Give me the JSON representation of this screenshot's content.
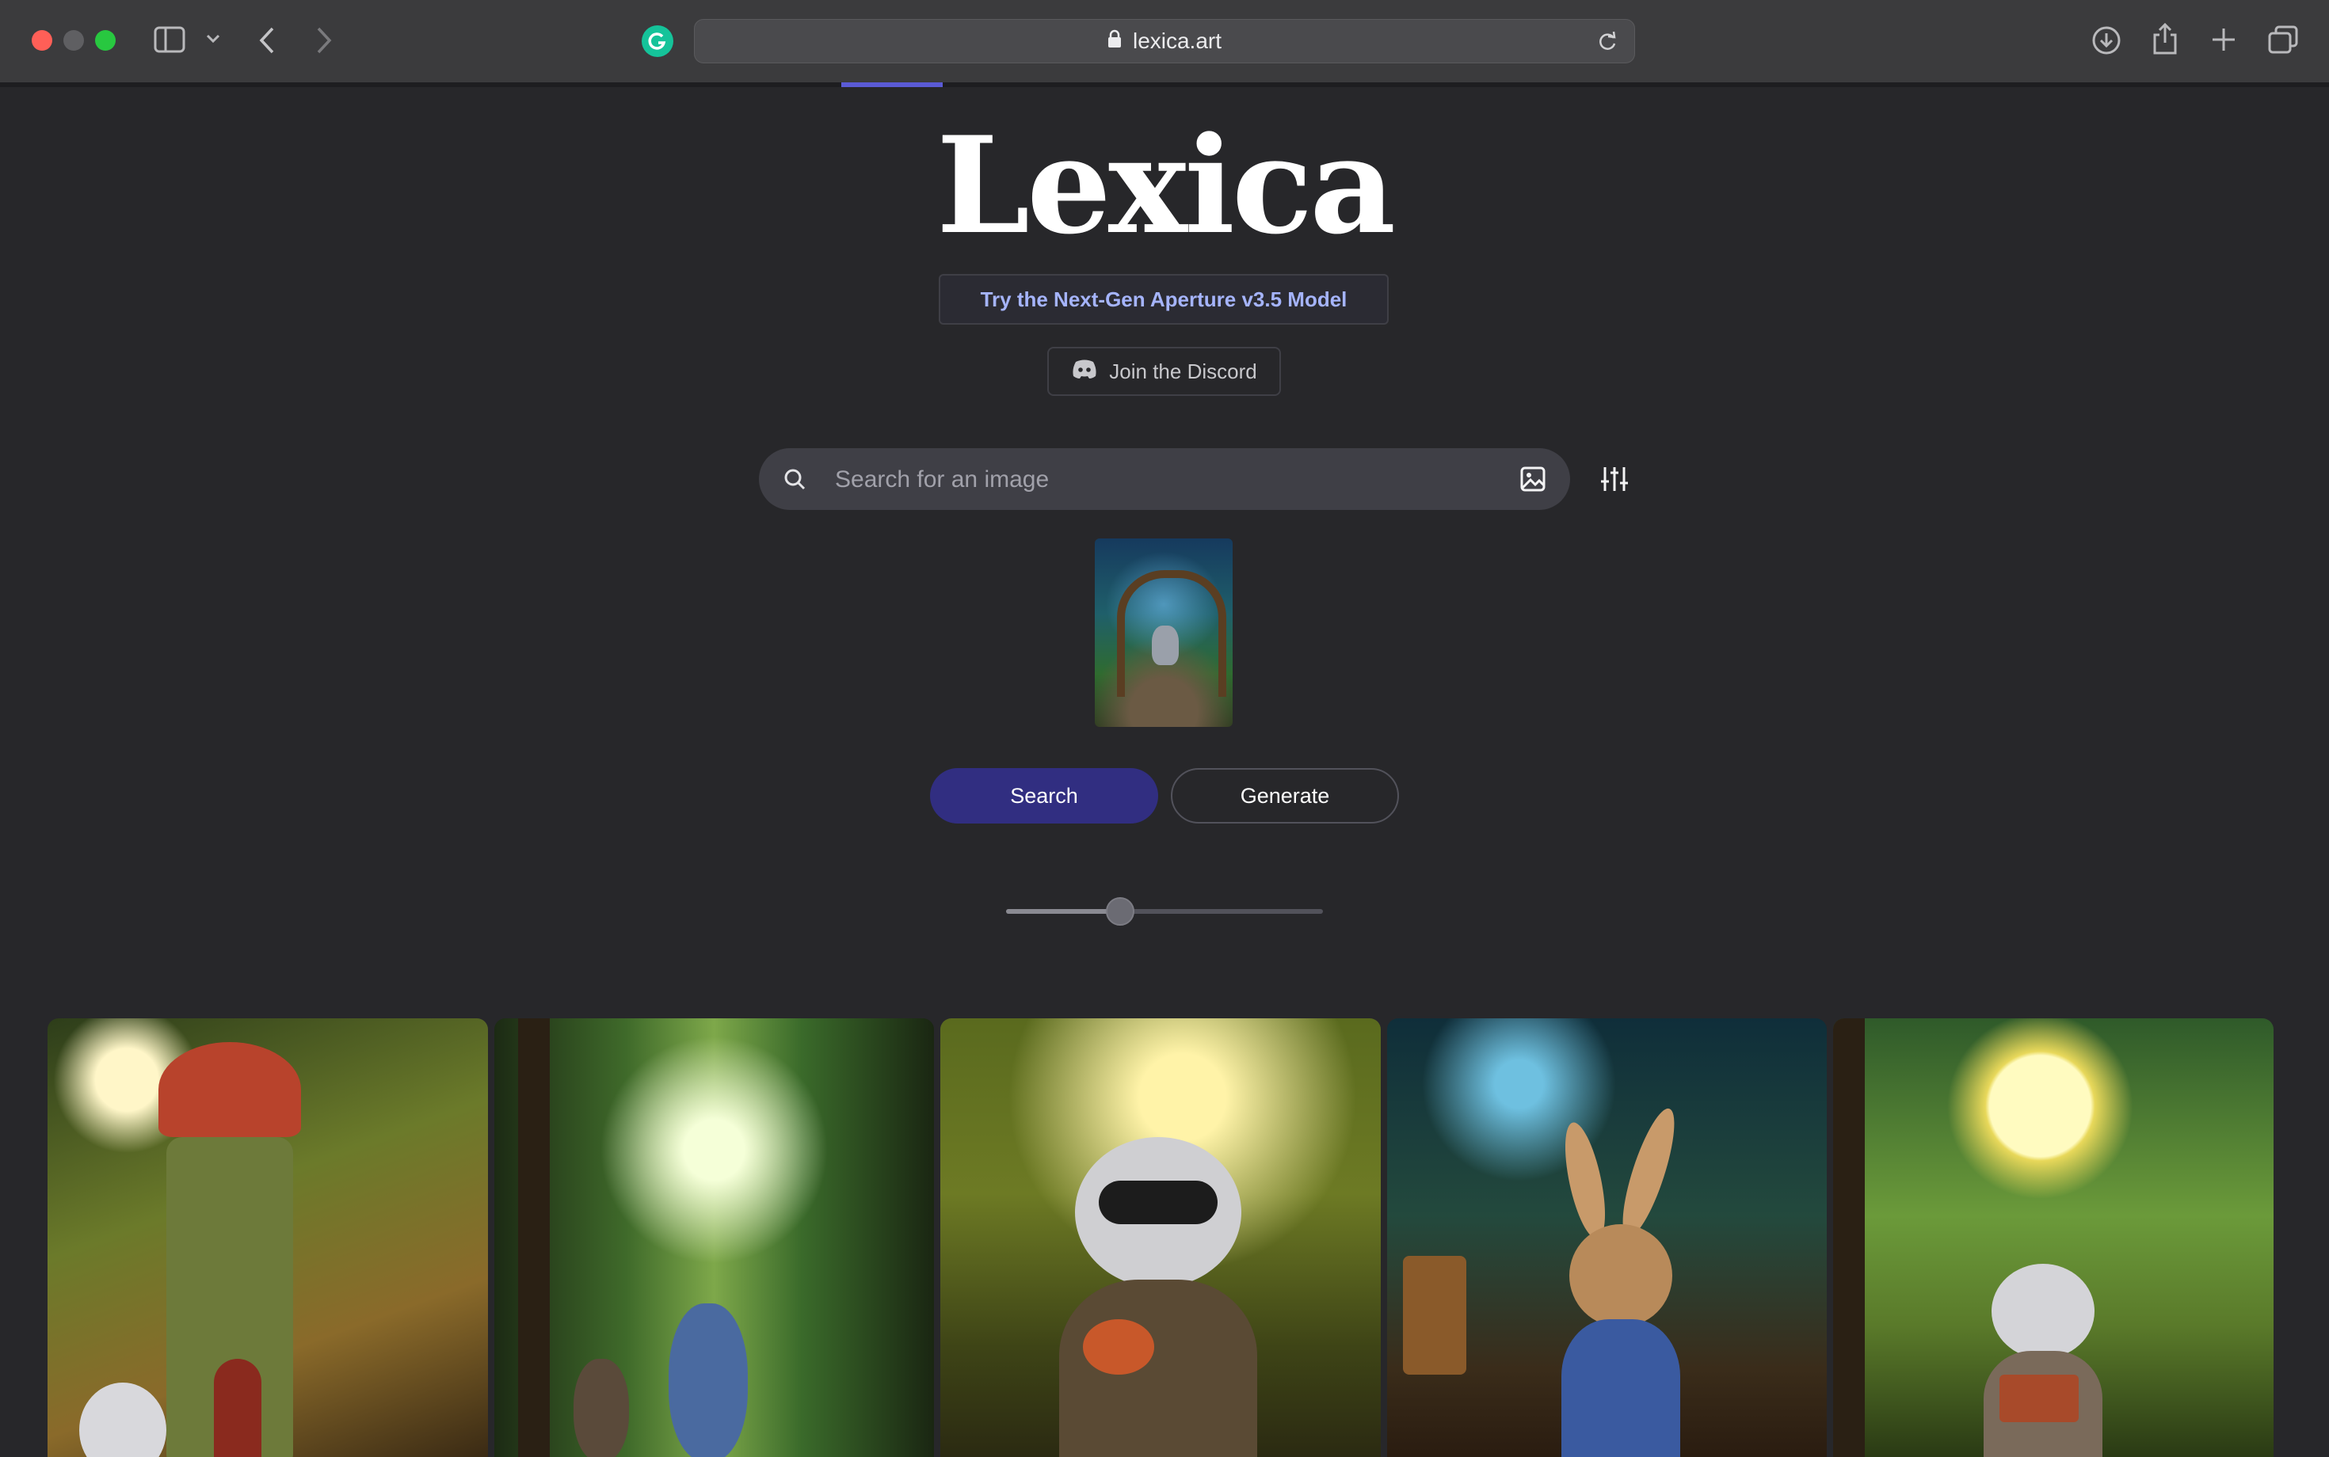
{
  "browser": {
    "url": "lexica.art",
    "icons": {
      "sidebar": "sidebar-icon",
      "back": "chevron-left-icon",
      "forward": "chevron-right-icon",
      "extension": "grammarly-icon",
      "lock": "lock-icon",
      "reload": "reload-icon",
      "downloads": "download-icon",
      "share": "share-icon",
      "new_tab": "plus-icon",
      "tabs": "tabs-overview-icon"
    }
  },
  "page": {
    "logo": "Lexica",
    "promo_label": "Try the Next-Gen Aperture v3.5 Model",
    "discord_label": "Join the Discord",
    "search": {
      "placeholder": "Search for an image",
      "value": ""
    },
    "buttons": {
      "search": "Search",
      "generate": "Generate"
    },
    "zoom_slider": {
      "value_fraction": 0.36
    }
  },
  "colors": {
    "background": "#27272a",
    "accent": "#312e81",
    "promo_text": "#a5b4fc"
  },
  "gallery": {
    "images": [
      {
        "name": "treehouse-bunny"
      },
      {
        "name": "forest-raccoons"
      },
      {
        "name": "raccoon-autumn"
      },
      {
        "name": "rabbit-reading"
      },
      {
        "name": "raccoon-moon-book"
      }
    ]
  }
}
